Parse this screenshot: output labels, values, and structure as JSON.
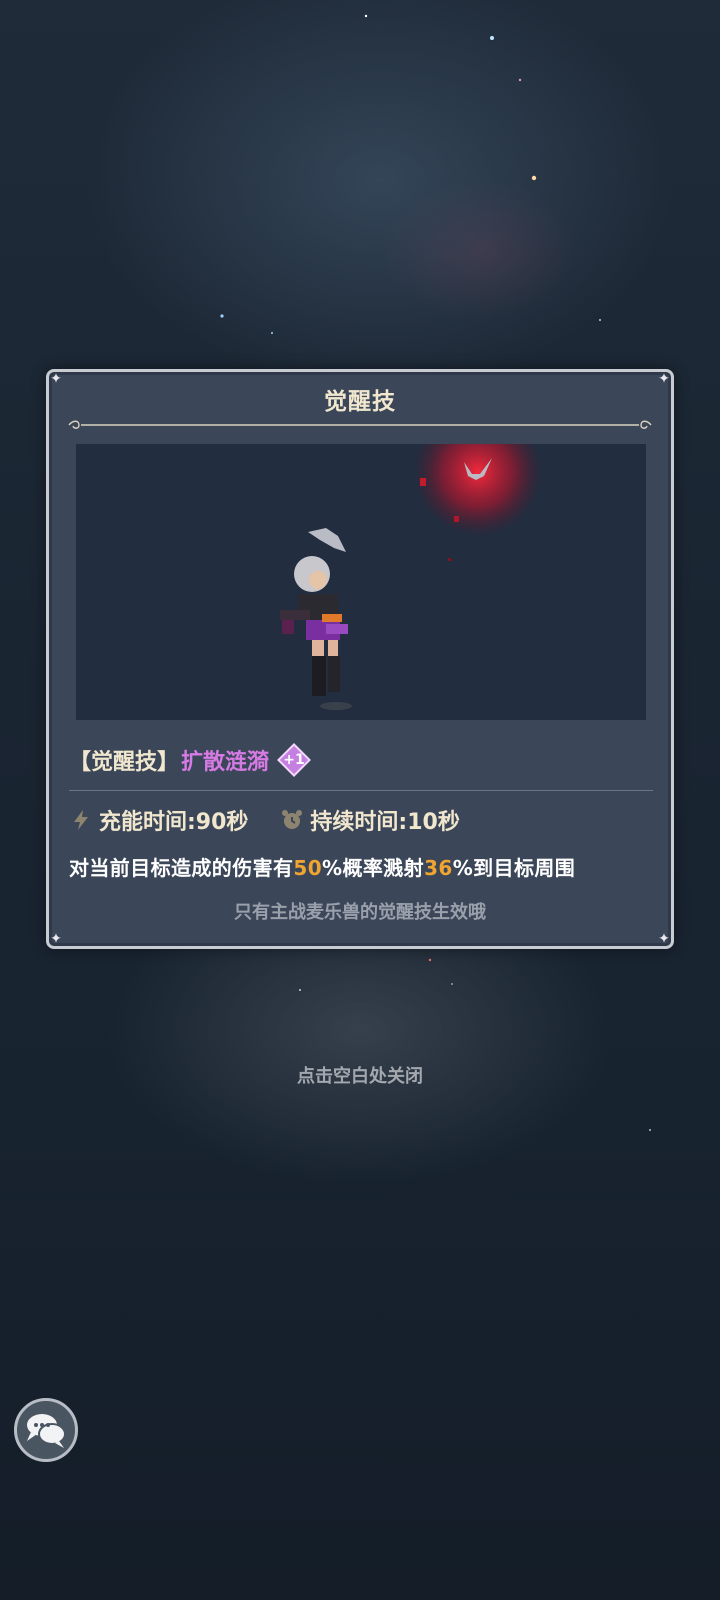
{
  "modal": {
    "title": "觉醒技",
    "skill_bracket_label": "【觉醒技】",
    "skill_name": "扩散涟漪",
    "level_badge": "+1",
    "charge_time": "充能时间:90秒",
    "duration": "持续时间:10秒",
    "description": {
      "part1": "对当前目标造成的伤害有",
      "value1": "50",
      "part2": "%概率溅射",
      "value2": "36",
      "part3": "%到目标周围"
    },
    "note": "只有主战麦乐兽的觉醒技生效哦"
  },
  "close_hint": "点击空白处关闭",
  "icons": {
    "charge": "lightning-icon",
    "duration": "alarm-clock-icon",
    "chat": "chat-bubbles-icon"
  },
  "colors": {
    "panel_bg": "#3b4658",
    "title_text": "#f1e7cf",
    "skill_name": "#d67ae4",
    "highlight": "#f0a431",
    "badge": "#c47fe0"
  }
}
